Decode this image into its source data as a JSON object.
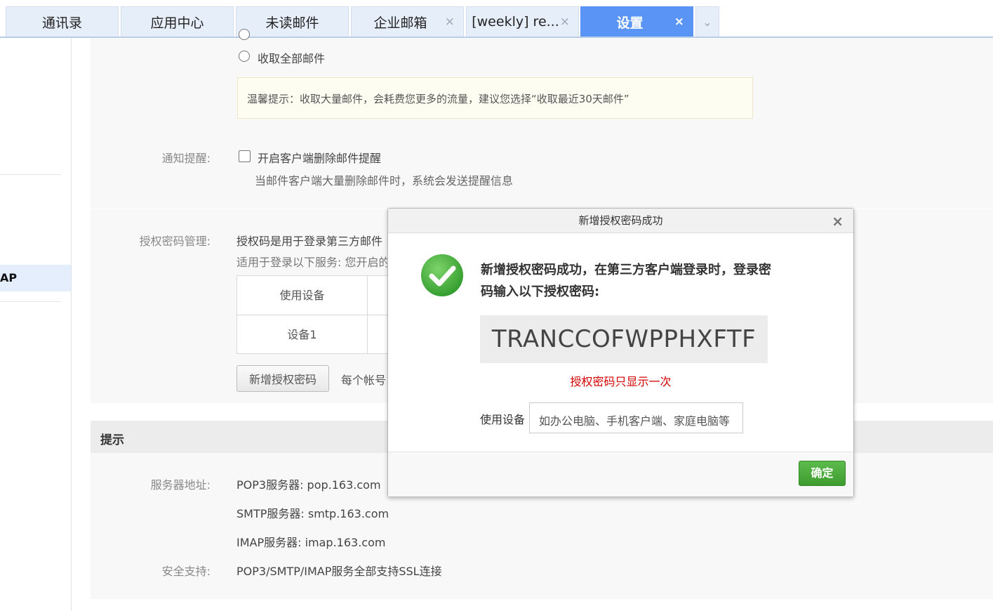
{
  "tabs": [
    {
      "label": "通讯录",
      "closable": false
    },
    {
      "label": "应用中心",
      "closable": false
    },
    {
      "label": "未读邮件",
      "closable": false
    },
    {
      "label": "企业邮箱",
      "closable": true
    },
    {
      "label": "[weekly] re...",
      "closable": true
    },
    {
      "label": "设置",
      "closable": true,
      "active": true
    }
  ],
  "close_glyph": "×",
  "more_glyph": "⌄",
  "sidebar": {
    "active_item": "AP"
  },
  "settings": {
    "receive_all_option": "收取全部邮件",
    "tip": "温馨提示：收取大量邮件，会耗费您更多的流量，建议您选择“收取最近30天邮件”",
    "notify_label": "通知提醒:",
    "notify_checkbox": "开启客户端删除邮件提醒",
    "notify_desc": "当邮件客户端大量删除邮件时，系统会发送提醒信息",
    "auth_label": "授权密码管理:",
    "auth_desc1": "授权码是用于登录第三方邮件",
    "auth_desc2": "适用于登录以下服务: 您开启的",
    "device_table": {
      "header": "使用设备",
      "rows": [
        "设备1"
      ]
    },
    "add_auth_button": "新增授权密码",
    "per_account_text": "每个帐号"
  },
  "tips_section": {
    "title": "提示",
    "server_label": "服务器地址:",
    "pop3": "POP3服务器: pop.163.com",
    "smtp": "SMTP服务器: smtp.163.com",
    "imap": "IMAP服务器: imap.163.com",
    "security_label": "安全支持:",
    "security_text": "POP3/SMTP/IMAP服务全部支持SSL连接"
  },
  "dialog": {
    "title": "新增授权密码成功",
    "message": "新增授权密码成功，在第三方客户端登录时，登录密码输入以下授权密码:",
    "password": "TRANCCOFWPPHXFTF",
    "show_once": "授权密码只显示一次",
    "device_label": "使用设备",
    "device_placeholder": "如办公电脑、手机客户端、家庭电脑等",
    "ok_button": "确定",
    "colors": {
      "ok": "#4aab3a",
      "warning": "#d40000",
      "check": "#3fae3a"
    }
  }
}
